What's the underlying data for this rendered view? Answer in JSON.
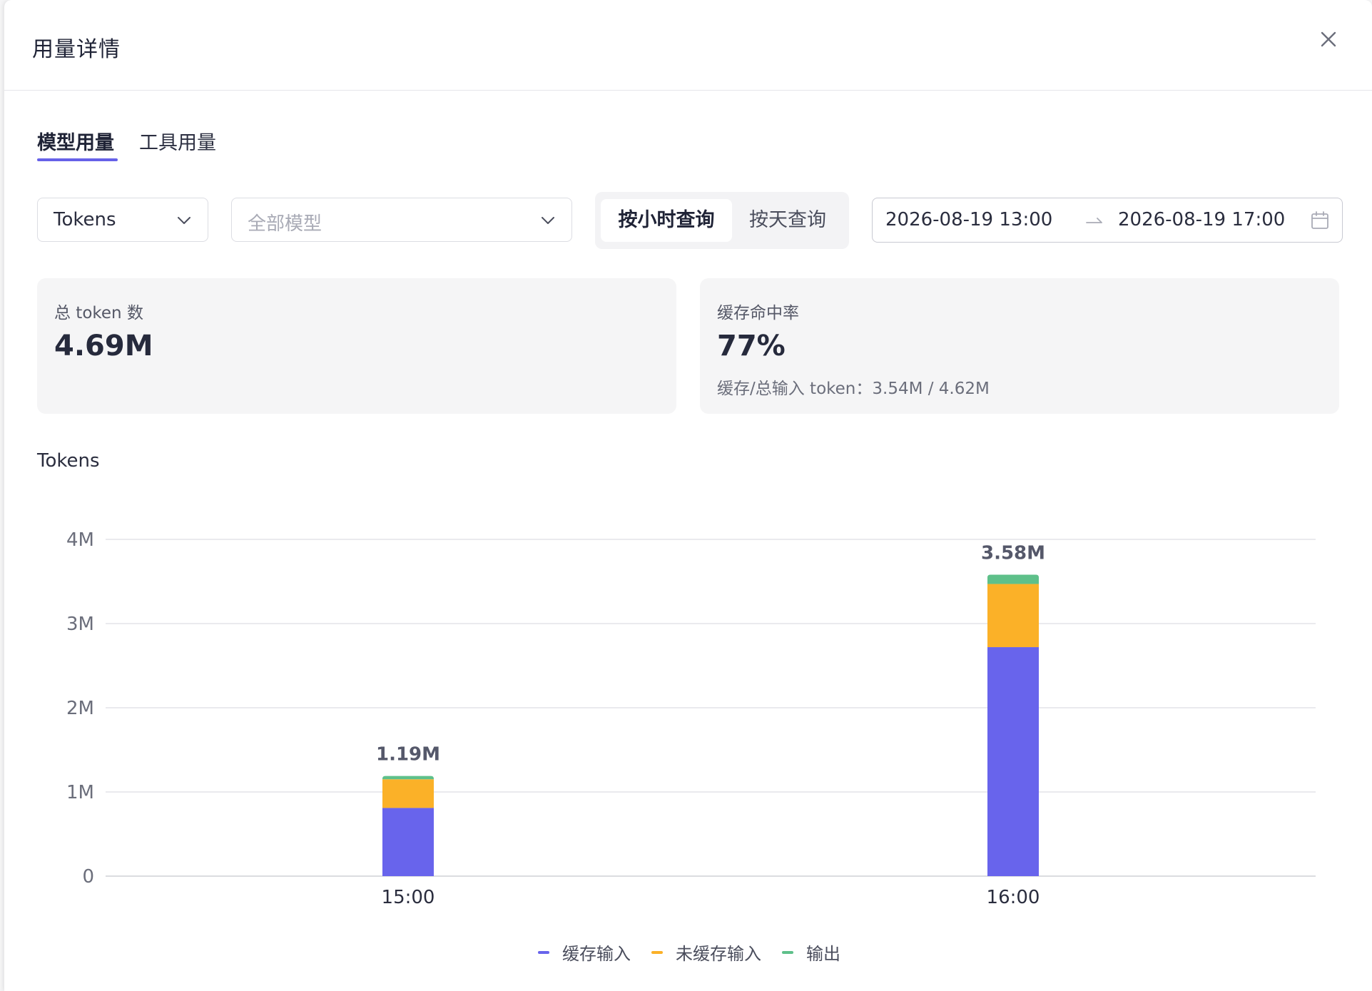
{
  "modal": {
    "title": "用量详情"
  },
  "tabs": [
    {
      "label": "模型用量",
      "active": true
    },
    {
      "label": "工具用量",
      "active": false
    }
  ],
  "filters": {
    "metric_select": {
      "value": "Tokens"
    },
    "model_select": {
      "placeholder": "全部模型"
    },
    "granularity": [
      {
        "label": "按小时查询",
        "active": true
      },
      {
        "label": "按天查询",
        "active": false
      }
    ],
    "date_range": {
      "start": "2026-08-19 13:00",
      "end": "2026-08-19 17:00"
    }
  },
  "stats": {
    "total_tokens": {
      "label": "总 token 数",
      "value": "4.69M"
    },
    "cache_hit": {
      "label": "缓存命中率",
      "value": "77%",
      "detail": "缓存/总输入 token：3.54M / 4.62M"
    }
  },
  "colors": {
    "accent": "#6661e8",
    "cached_input": "#6864ec",
    "uncached_input": "#fbb128",
    "output": "#5ec08a"
  },
  "chart_data": {
    "type": "bar",
    "stacked": true,
    "title": "Tokens",
    "categories": [
      "15:00",
      "16:00"
    ],
    "series": [
      {
        "name": "缓存输入",
        "values": [
          0.81,
          2.72
        ]
      },
      {
        "name": "未缓存输入",
        "values": [
          0.34,
          0.75
        ]
      },
      {
        "name": "输出",
        "values": [
          0.04,
          0.11
        ]
      }
    ],
    "totals": [
      "1.19M",
      "3.58M"
    ],
    "y_ticks": [
      "0",
      "1M",
      "2M",
      "3M",
      "4M"
    ],
    "ylim": [
      0,
      4
    ],
    "grid": true,
    "legend_position": "bottom"
  }
}
